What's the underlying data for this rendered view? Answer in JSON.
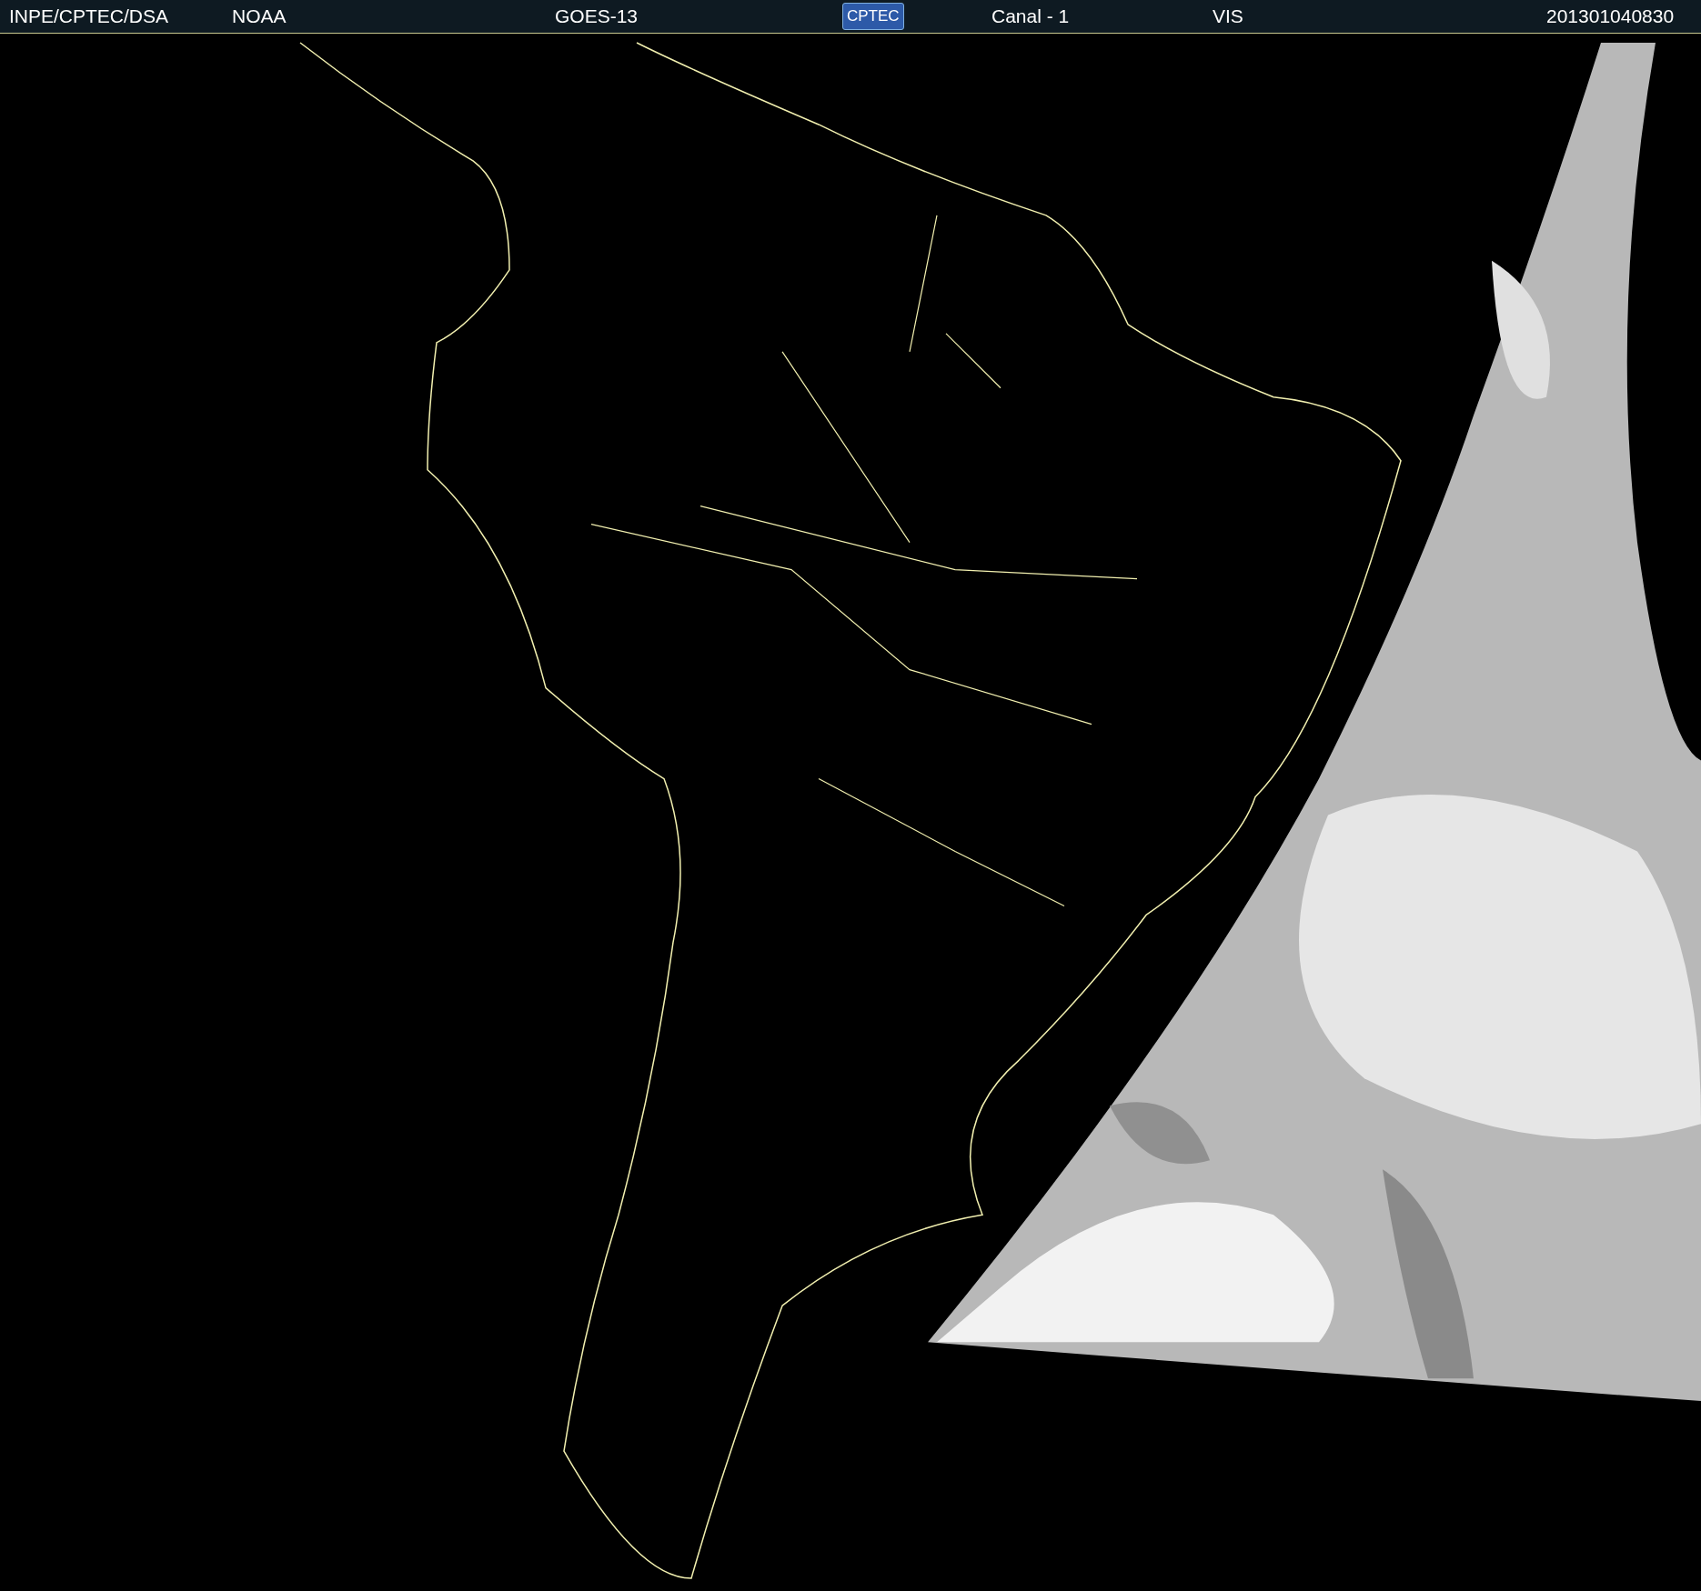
{
  "header": {
    "items": [
      {
        "kind": "text",
        "text": "INPE/CPTEC/DSA"
      },
      {
        "kind": "text",
        "text": "NOAA"
      },
      {
        "kind": "text",
        "text": "GOES-13"
      },
      {
        "kind": "logo",
        "text": "CPTEC"
      },
      {
        "kind": "text",
        "text": "Canal - 1"
      },
      {
        "kind": "text",
        "text": "VIS"
      },
      {
        "kind": "text",
        "text": "201301040830"
      }
    ]
  }
}
